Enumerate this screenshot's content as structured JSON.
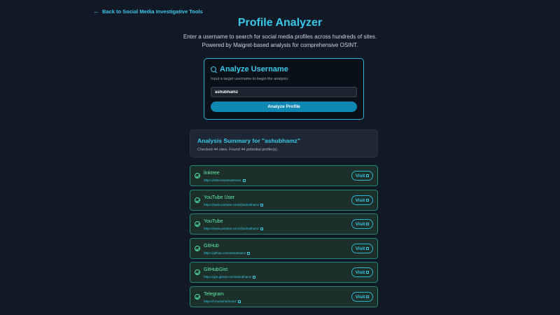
{
  "nav": {
    "back_label": "Back to Social Media Investigative Tools"
  },
  "header": {
    "title": "Profile Analyzer",
    "subtitle_line1": "Enter a username to search for social media profiles across hundreds of sites.",
    "subtitle_line2": "Powered by Maigret-based analysis for comprehensive OSINT."
  },
  "analyze_card": {
    "title": "Analyze Username",
    "description": "Input a target username to begin the analysis.",
    "input_value": "ashubhamz",
    "button_label": "Analyze Profile"
  },
  "summary": {
    "title": "Analysis Summary for \"ashubhamz\"",
    "text": "Checked 44 sites. Found 44 potential profile(s)."
  },
  "results": [
    {
      "name": "linktree",
      "url": "https://linktr.ee/ashubhamz",
      "visit_label": "Visit"
    },
    {
      "name": "YouTube User",
      "url": "https://www.youtube.com/@ashubhamz",
      "visit_label": "Visit"
    },
    {
      "name": "YouTube",
      "url": "https://www.youtube.com/@ashubhamz",
      "visit_label": "Visit"
    },
    {
      "name": "GitHub",
      "url": "https://github.com/ashubhamz",
      "visit_label": "Visit"
    },
    {
      "name": "GitHubGist",
      "url": "https://gist.github.com/ashubhamz",
      "visit_label": "Visit"
    },
    {
      "name": "Telegram",
      "url": "https://t.me/ashubhamz",
      "visit_label": "Visit"
    }
  ],
  "colors": {
    "accent": "#38c8e8",
    "success": "#5ff0a8",
    "background": "#111826"
  }
}
